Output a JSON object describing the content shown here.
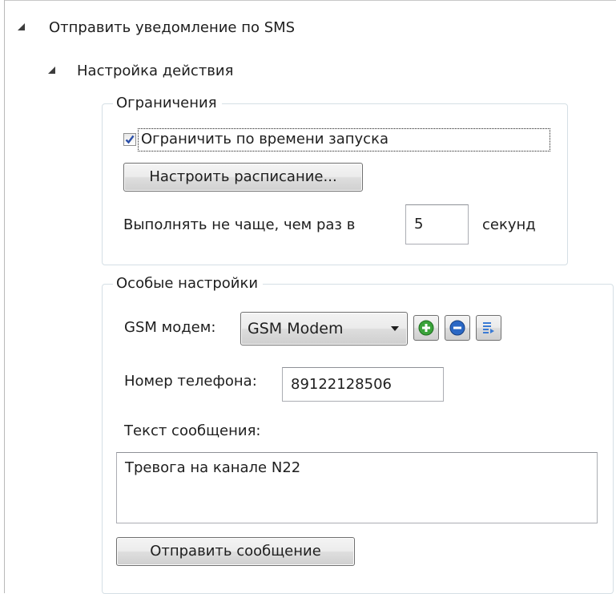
{
  "tree": {
    "root_label": "Отправить уведомление по SMS",
    "child_label": "Настройка действия"
  },
  "limits": {
    "group_label": "Ограничения",
    "checkbox_label": "Ограничить по времени запуска",
    "checkbox_checked": true,
    "schedule_button": "Настроить расписание...",
    "rate_label": "Выполнять не чаще, чем раз в",
    "rate_value": "5",
    "rate_unit": "секунд"
  },
  "special": {
    "group_label": "Особые настройки",
    "modem_label": "GSM модем:",
    "modem_selected": "GSM Modem",
    "add_icon": "plus-circle-icon",
    "remove_icon": "minus-circle-icon",
    "edit_icon": "edit-list-icon",
    "phone_label": "Номер телефона:",
    "phone_value": "89122128506",
    "message_label": "Текст сообщения:",
    "message_value": "Тревога на канале N22",
    "send_button": "Отправить сообщение"
  }
}
